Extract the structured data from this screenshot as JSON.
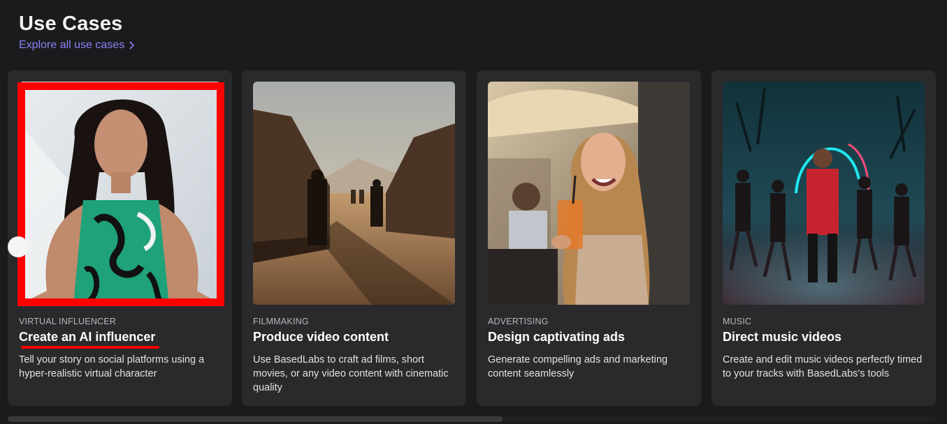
{
  "header": {
    "title": "Use Cases",
    "explore_label": "Explore all use cases"
  },
  "cards": [
    {
      "category": "VIRTUAL INFLUENCER",
      "title": "Create an AI influencer",
      "description": "Tell your story on social platforms using a hyper-realistic virtual character"
    },
    {
      "category": "FILMMAKING",
      "title": "Produce video content",
      "description": "Use BasedLabs to craft ad films, short movies, or any video content with cinematic quality"
    },
    {
      "category": "ADVERTISING",
      "title": "Design captivating ads",
      "description": "Generate compelling ads and marketing content seamlessly"
    },
    {
      "category": "MUSIC",
      "title": "Direct music videos",
      "description": "Create and edit music videos perfectly timed to your tracks with BasedLabs's tools"
    }
  ],
  "colors": {
    "background": "#1b1b1d",
    "card": "#2a2a2d",
    "link": "#8a83f5",
    "highlight": "#ff0000"
  },
  "icons": {
    "explore_chevron": "chevron-right-icon",
    "carousel_prev": "chevron-left-icon"
  }
}
